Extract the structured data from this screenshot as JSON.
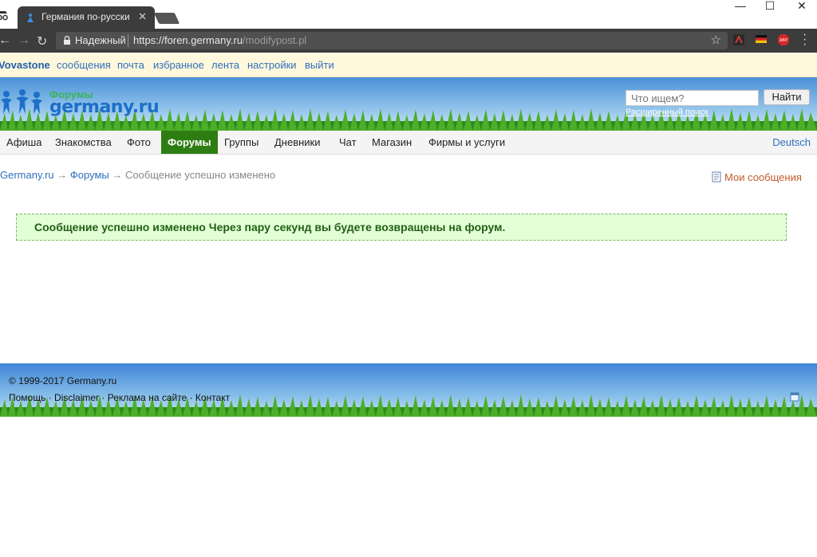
{
  "browser": {
    "tab_title": "Германия по-русски",
    "tab_close": "✕",
    "secure_label": "Надежный",
    "url_host": "https://foren.germany.ru",
    "url_path": "/modifypost.pl",
    "window_controls": {
      "minimize": "—",
      "maximize": "☐",
      "close": "✕"
    }
  },
  "userbar": {
    "username": "Vovastone",
    "links": [
      "сообщения",
      "почта",
      "избранное",
      "лента",
      "настройки",
      "выйти"
    ]
  },
  "header": {
    "logo_small": "Форумы",
    "logo_big": "germany.ru",
    "search_placeholder": "Что ищем?",
    "search_button": "Найти",
    "advanced_search": "Расширенный поиск"
  },
  "mainnav": {
    "items": [
      "Афиша",
      "Знакомства",
      "Фото",
      "Форумы",
      "Группы",
      "Дневники",
      "Чат",
      "Магазин",
      "Фирмы и услуги"
    ],
    "active": "Форумы",
    "language": "Deutsch"
  },
  "breadcrumb": {
    "root": "Germany.ru",
    "section": "Форумы",
    "current": "Сообщение успешно изменено",
    "separator": "→"
  },
  "my_messages": "Мои сообщения",
  "success_message": "Сообщение успешно изменено Через пару секунд вы будете возвращены на форум.",
  "footer": {
    "copyright": "© 1999-2017 Germany.ru",
    "links": [
      "Помощь",
      "Disclaimer",
      "Реклама на сайте",
      "Контакт"
    ]
  },
  "colors": {
    "link": "#2f6fbf",
    "nav_active": "#2e7d12",
    "success_bg": "#e2ffd8",
    "success_text": "#225f12",
    "chrome_dark": "#3c3c3c"
  },
  "icons": [
    "incognito-icon",
    "favicon-icon",
    "back-icon",
    "forward-icon",
    "reload-icon",
    "lock-icon",
    "star-icon",
    "pdf-extension-icon",
    "flag-extension-icon",
    "adblock-extension-icon",
    "menu-icon",
    "messages-icon",
    "footer-icon"
  ]
}
